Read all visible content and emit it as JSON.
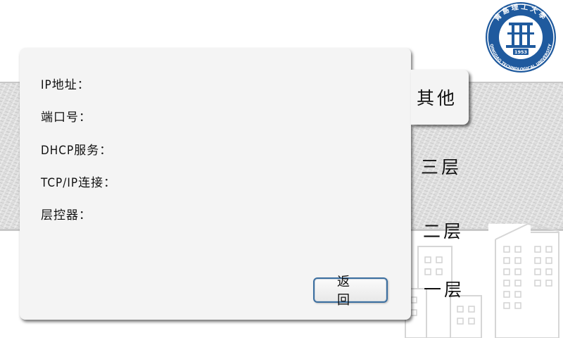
{
  "logo": {
    "top_text": "青島理工大學",
    "bottom_text": "QINGDAO TECHNOLOGICAL UNIVERSITY",
    "year": "1953",
    "color": "#1f5a9e"
  },
  "panel": {
    "fields": [
      {
        "label": "IP地址："
      },
      {
        "label": "端口号："
      },
      {
        "label": "DHCP服务："
      },
      {
        "label": "TCP/IP连接："
      },
      {
        "label": "层控器："
      }
    ],
    "back_button": "返回"
  },
  "tabs": {
    "active": "其他",
    "floor3": "三层",
    "floor2": "二层",
    "floor1": "一层"
  },
  "colors": {
    "button_border": "#3c6fa0",
    "panel_bg": "#f4f4f4",
    "band_bg": "#dcdcdc"
  }
}
